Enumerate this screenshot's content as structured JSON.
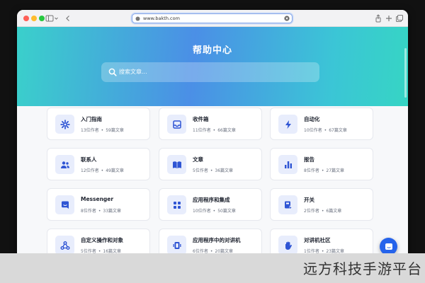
{
  "browser": {
    "url": "www.bakth.com",
    "controls": [
      "sidebar-toggle-icon",
      "back-icon",
      "share-icon",
      "new-tab-icon",
      "tabs-icon"
    ]
  },
  "hero": {
    "title": "帮助中心",
    "search_placeholder": "搜索文章..."
  },
  "cards": [
    {
      "title": "入门指南",
      "authors": "13位作者",
      "articles": "59篇文章",
      "icon": "gear-icon"
    },
    {
      "title": "收件箱",
      "authors": "11位作者",
      "articles": "66篇文章",
      "icon": "inbox-icon"
    },
    {
      "title": "自动化",
      "authors": "10位作者",
      "articles": "67篇文章",
      "icon": "bolt-icon"
    },
    {
      "title": "联系人",
      "authors": "12位作者",
      "articles": "49篇文章",
      "icon": "contacts-icon"
    },
    {
      "title": "文章",
      "authors": "5位作者",
      "articles": "36篇文章",
      "icon": "book-icon"
    },
    {
      "title": "报告",
      "authors": "8位作者",
      "articles": "27篇文章",
      "icon": "bar-chart-icon"
    },
    {
      "title": "Messenger",
      "authors": "8位作者",
      "articles": "33篇文章",
      "icon": "messenger-icon"
    },
    {
      "title": "应用程序和集成",
      "authors": "10位作者",
      "articles": "50篇文章",
      "icon": "apps-grid-icon"
    },
    {
      "title": "开关",
      "authors": "2位作者",
      "articles": "6篇文章",
      "icon": "switch-icon"
    },
    {
      "title": "自定义操作和对象",
      "authors": "5位作者",
      "articles": "16篇文章",
      "icon": "webhook-icon"
    },
    {
      "title": "应用程序中的对讲机",
      "authors": "6位作者",
      "articles": "20篇文章",
      "icon": "walkie-talkie-icon"
    },
    {
      "title": "对讲机社区",
      "authors": "1位作者",
      "articles": "23篇文章",
      "icon": "hand-wave-icon"
    }
  ],
  "separator": "•",
  "watermark": "远方科技手游平台",
  "colors": {
    "accent": "#2563eb",
    "icon_bg": "#e8edfc",
    "icon_fg": "#2f55d4"
  }
}
